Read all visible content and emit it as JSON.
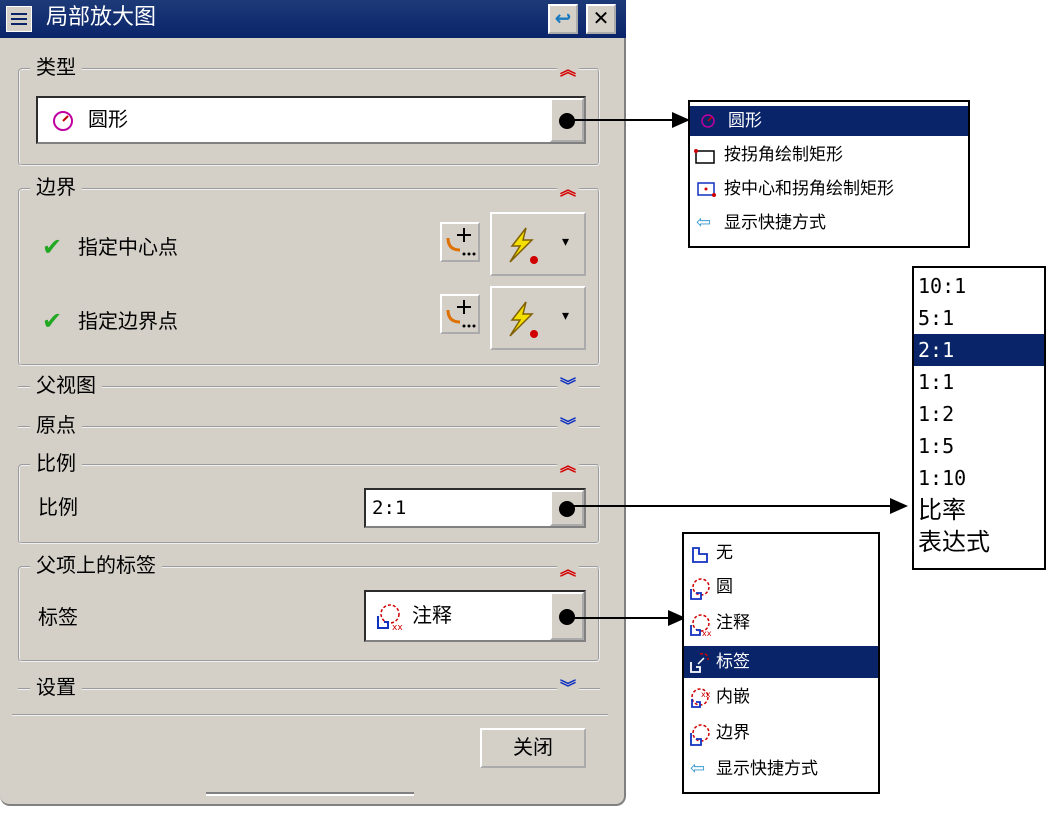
{
  "dialog": {
    "title": "局部放大图",
    "close_label": "关闭"
  },
  "groups": {
    "type": {
      "title": "类型",
      "value": "圆形"
    },
    "boundary": {
      "title": "边界",
      "center_label": "指定中心点",
      "boundary_label": "指定边界点"
    },
    "parent_view": {
      "title": "父视图"
    },
    "origin": {
      "title": "原点"
    },
    "scale": {
      "title": "比例",
      "label": "比例",
      "value": "2:1"
    },
    "parent_label": {
      "title": "父项上的标签",
      "label": "标签",
      "value": "注释"
    },
    "settings": {
      "title": "设置"
    }
  },
  "type_menu": [
    "圆形",
    "按拐角绘制矩形",
    "按中心和拐角绘制矩形",
    "显示快捷方式"
  ],
  "scale_menu": [
    "10:1",
    "5:1",
    "2:1",
    "1:1",
    "1:2",
    "1:5",
    "1:10",
    "比率",
    "表达式"
  ],
  "label_menu": [
    "无",
    "圆",
    "注释",
    "标签",
    "内嵌",
    "边界",
    "显示快捷方式"
  ],
  "chevrons": {
    "expanded": "≈",
    "collapsed": "≈"
  },
  "colors": {
    "selection": "#0a246a",
    "check": "#22a822",
    "expand": "#d40000",
    "collapse": "#1030c0"
  }
}
